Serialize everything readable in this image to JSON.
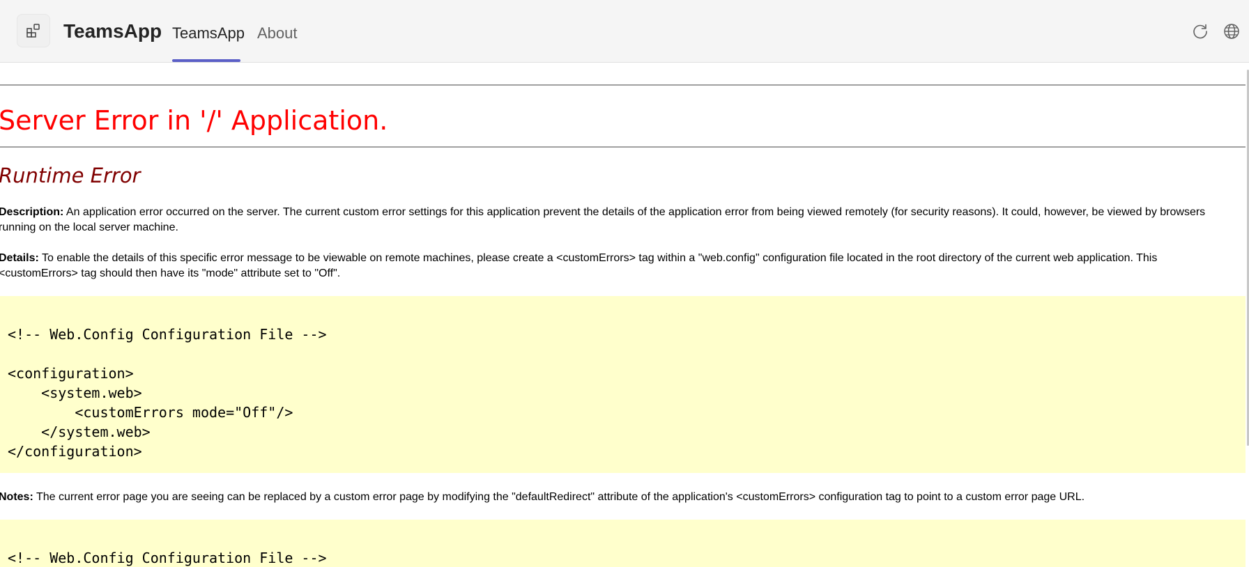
{
  "header": {
    "app_icon": "apps-icon",
    "app_title": "TeamsApp",
    "tabs": [
      {
        "label": "TeamsApp",
        "active": true
      },
      {
        "label": "About",
        "active": false
      }
    ],
    "accent_color": "#5b5fc7",
    "actions": [
      "refresh-icon",
      "globe-icon"
    ]
  },
  "error_page": {
    "title": "Server Error in '/' Application.",
    "subtitle": "Runtime Error",
    "description_label": "Description:",
    "description_text": " An application error occurred on the server. The current custom error settings for this application prevent the details of the application error from being viewed remotely (for security reasons). It could, however, be viewed by browsers running on the local server machine.",
    "details_label": "Details:",
    "details_text": " To enable the details of this specific error message to be viewable on remote machines, please create a <customErrors> tag within a \"web.config\" configuration file located in the root directory of the current web application. This <customErrors> tag should then have its \"mode\" attribute set to \"Off\".",
    "code_block_1": "<!-- Web.Config Configuration File -->\n\n<configuration>\n    <system.web>\n        <customErrors mode=\"Off\"/>\n    </system.web>\n</configuration>",
    "notes_label": "Notes:",
    "notes_text": " The current error page you are seeing can be replaced by a custom error page by modifying the \"defaultRedirect\" attribute of the application's <customErrors> configuration tag to point to a custom error page URL.",
    "code_block_2": "<!-- Web.Config Configuration File -->",
    "title_color": "#ff0000",
    "subtitle_color": "#800000",
    "code_background": "#ffffcc"
  }
}
